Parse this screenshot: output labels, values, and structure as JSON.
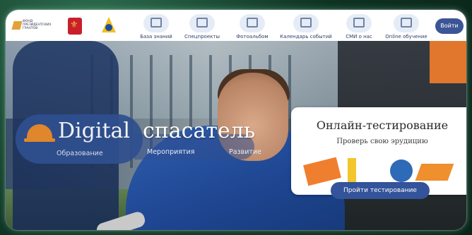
{
  "header": {
    "fund_logo_text": "Фонд президентских грантов",
    "nav": [
      {
        "label": "База знаний",
        "icon": "bank-icon"
      },
      {
        "label": "Спецпроекты",
        "icon": "award-icon"
      },
      {
        "label": "Фотоальбом",
        "icon": "camera-icon"
      },
      {
        "label": "Календарь событий",
        "icon": "calendar-icon"
      },
      {
        "label": "СМИ о нас",
        "icon": "news-icon"
      },
      {
        "label": "Online обучение",
        "icon": "graduation-icon"
      }
    ],
    "login_label": "Войти"
  },
  "hero": {
    "brand_word1": "Digital",
    "brand_word2": "спасатель",
    "links": [
      "Образование",
      "Мероприятия",
      "Развитие"
    ]
  },
  "test_card": {
    "title": "Онлайн-тестирование",
    "subtitle": "Проверь свою эрудицию",
    "button_label": "Пройти тестирование"
  },
  "colors": {
    "primary": "#33539a",
    "accent": "#ef8c2a",
    "frame": "#0e3223"
  }
}
